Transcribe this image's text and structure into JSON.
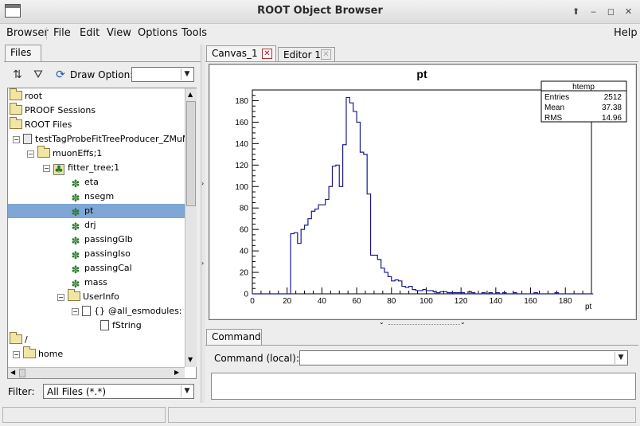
{
  "window": {
    "title": "ROOT Object Browser"
  },
  "menu": {
    "items": [
      {
        "label": "Browser",
        "id": "browser"
      },
      {
        "label": "File",
        "id": "file"
      },
      {
        "label": "Edit",
        "id": "edit"
      },
      {
        "label": "View",
        "id": "view"
      },
      {
        "label": "Options",
        "id": "options"
      },
      {
        "label": "Tools",
        "id": "tools"
      }
    ],
    "help": "Help"
  },
  "left_panel": {
    "tab": "Files",
    "draw_option_label": "Draw Option:",
    "draw_option_value": "",
    "filter_label": "Filter:",
    "filter_value": "All Files (*.*)",
    "tree": [
      {
        "label": "root",
        "icon": "folder-icon"
      },
      {
        "label": "PROOF Sessions",
        "icon": "folder-icon"
      },
      {
        "label": "ROOT Files",
        "icon": "folder-icon"
      },
      {
        "label": "testTagProbeFitTreeProducer_ZMuMu.r",
        "icon": "root-file-icon"
      },
      {
        "label": "muonEffs;1",
        "icon": "folder-icon"
      },
      {
        "label": "fitter_tree;1",
        "icon": "tree-icon"
      },
      {
        "label": "eta",
        "icon": "leaf-icon"
      },
      {
        "label": "nsegm",
        "icon": "leaf-icon"
      },
      {
        "label": "pt",
        "icon": "leaf-icon",
        "selected": true
      },
      {
        "label": "drj",
        "icon": "leaf-icon"
      },
      {
        "label": "passingGlb",
        "icon": "leaf-icon"
      },
      {
        "label": "passingIso",
        "icon": "leaf-icon"
      },
      {
        "label": "passingCal",
        "icon": "leaf-icon"
      },
      {
        "label": "mass",
        "icon": "leaf-icon"
      },
      {
        "label": "UserInfo",
        "icon": "folder-icon"
      },
      {
        "label": "@all_esmodules: vs",
        "icon": "list-icon"
      },
      {
        "label": "fString",
        "icon": "document-icon"
      },
      {
        "label": "/",
        "icon": "folder-icon"
      },
      {
        "label": "home",
        "icon": "folder-icon"
      }
    ]
  },
  "right_panel": {
    "tabs": [
      {
        "label": "Canvas_1",
        "active": true
      },
      {
        "label": "Editor 1",
        "active": false
      }
    ],
    "command_tab": "Command",
    "command_label": "Command (local):",
    "command_value": ""
  },
  "colors": {
    "histogram_line": "#1a1a8c",
    "selection": "#7fa6d4",
    "close_icon": "#cc0000"
  },
  "chart_data": {
    "type": "histogram",
    "title": "pt",
    "xlabel": "pt",
    "ylabel": "",
    "xlim": [
      0,
      195
    ],
    "ylim": [
      0,
      190
    ],
    "xticks": [
      0,
      20,
      40,
      60,
      80,
      100,
      120,
      140,
      160,
      180
    ],
    "yticks": [
      0,
      20,
      40,
      60,
      80,
      100,
      120,
      140,
      160,
      180
    ],
    "stats": {
      "name": "htemp",
      "entries": "2512",
      "mean": "37.38",
      "rms": "14.96",
      "entries_label": "Entries",
      "mean_label": "Mean",
      "rms_label": "RMS"
    },
    "bin_width": 2,
    "bin_start": 0,
    "values": [
      0,
      0,
      0,
      0,
      0,
      0,
      0,
      0,
      0,
      0,
      0,
      56,
      57,
      47,
      60,
      64,
      70,
      77,
      79,
      83,
      83,
      88,
      100,
      119,
      120,
      100,
      139,
      183,
      178,
      170,
      160,
      132,
      130,
      93,
      36,
      36,
      32,
      24,
      20,
      16,
      12,
      13,
      12,
      7,
      6,
      7,
      4,
      3,
      3,
      4,
      3,
      3,
      2,
      1,
      2,
      2,
      1,
      1,
      1,
      1,
      1,
      0,
      2,
      1,
      0,
      0,
      1,
      0,
      1,
      0,
      1,
      0,
      1,
      0,
      0,
      1,
      0,
      0,
      0,
      0,
      0,
      1,
      0,
      0,
      0,
      0,
      0,
      1,
      0,
      0,
      0,
      0,
      0,
      0,
      0,
      0,
      0,
      0
    ]
  }
}
